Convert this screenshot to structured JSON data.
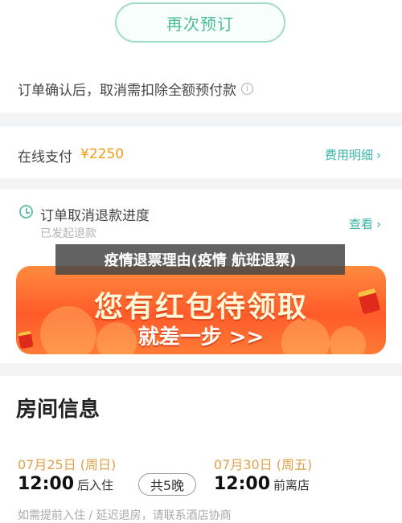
{
  "buttons": {
    "rebook": "再次预订"
  },
  "notice": {
    "text": "订单确认后，取消需扣除全额预付款"
  },
  "payment": {
    "label": "在线支付",
    "amount": "¥2250",
    "details_link": "费用明细"
  },
  "refund": {
    "title": "订单取消退款进度",
    "status": "已发起退款",
    "view_link": "查看"
  },
  "overlay_caption": "疫情退票理由(疫情 航班退票)",
  "banner": {
    "title": "您有红包待领取",
    "cta": "就差一步 >>"
  },
  "room": {
    "section_title": "房间信息",
    "checkin_date": "07月25日 (周日)",
    "checkin_time": "12:00",
    "checkin_label": "后入住",
    "nights": "共5晚",
    "checkout_date": "07月30日 (周五)",
    "checkout_time": "12:00",
    "checkout_label": "前离店",
    "policy": "如需提前入住 / 延迟退房，请联系酒店协商"
  },
  "colors": {
    "accent": "#4bbd98",
    "price": "#f39c12",
    "link": "#3ab6a8",
    "date": "#e0a14a"
  }
}
